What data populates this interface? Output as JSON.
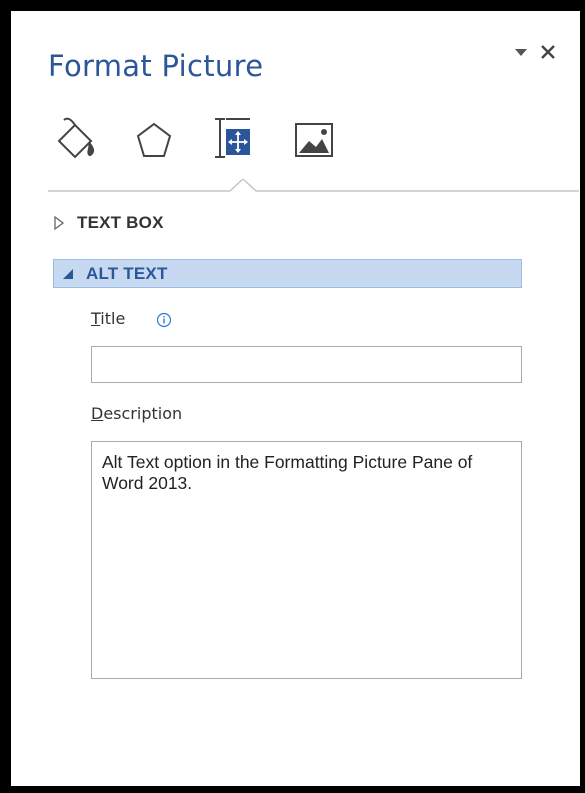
{
  "pane": {
    "title": "Format Picture",
    "icons": {
      "options": "dropdown-triangle-icon",
      "close": "close-icon"
    }
  },
  "tabs": [
    {
      "name": "fill-line",
      "icon": "paint-bucket-icon"
    },
    {
      "name": "effects",
      "icon": "pentagon-icon"
    },
    {
      "name": "size-properties",
      "icon": "layout-size-icon",
      "selected": true
    },
    {
      "name": "picture",
      "icon": "picture-icon"
    }
  ],
  "sections": {
    "text_box": {
      "label": "TEXT BOX",
      "expanded": false
    },
    "alt_text": {
      "label": "ALT TEXT",
      "expanded": true
    }
  },
  "alt_text": {
    "title_label_accel": "T",
    "title_label_rest": "itle",
    "title_value": "",
    "description_label_accel": "D",
    "description_label_rest": "escription",
    "description_value": "Alt Text option in the Formatting Picture Pane of Word 2013."
  },
  "colors": {
    "accent": "#2b579a",
    "section_highlight": "#c7d9f1",
    "frame": "#000000"
  }
}
